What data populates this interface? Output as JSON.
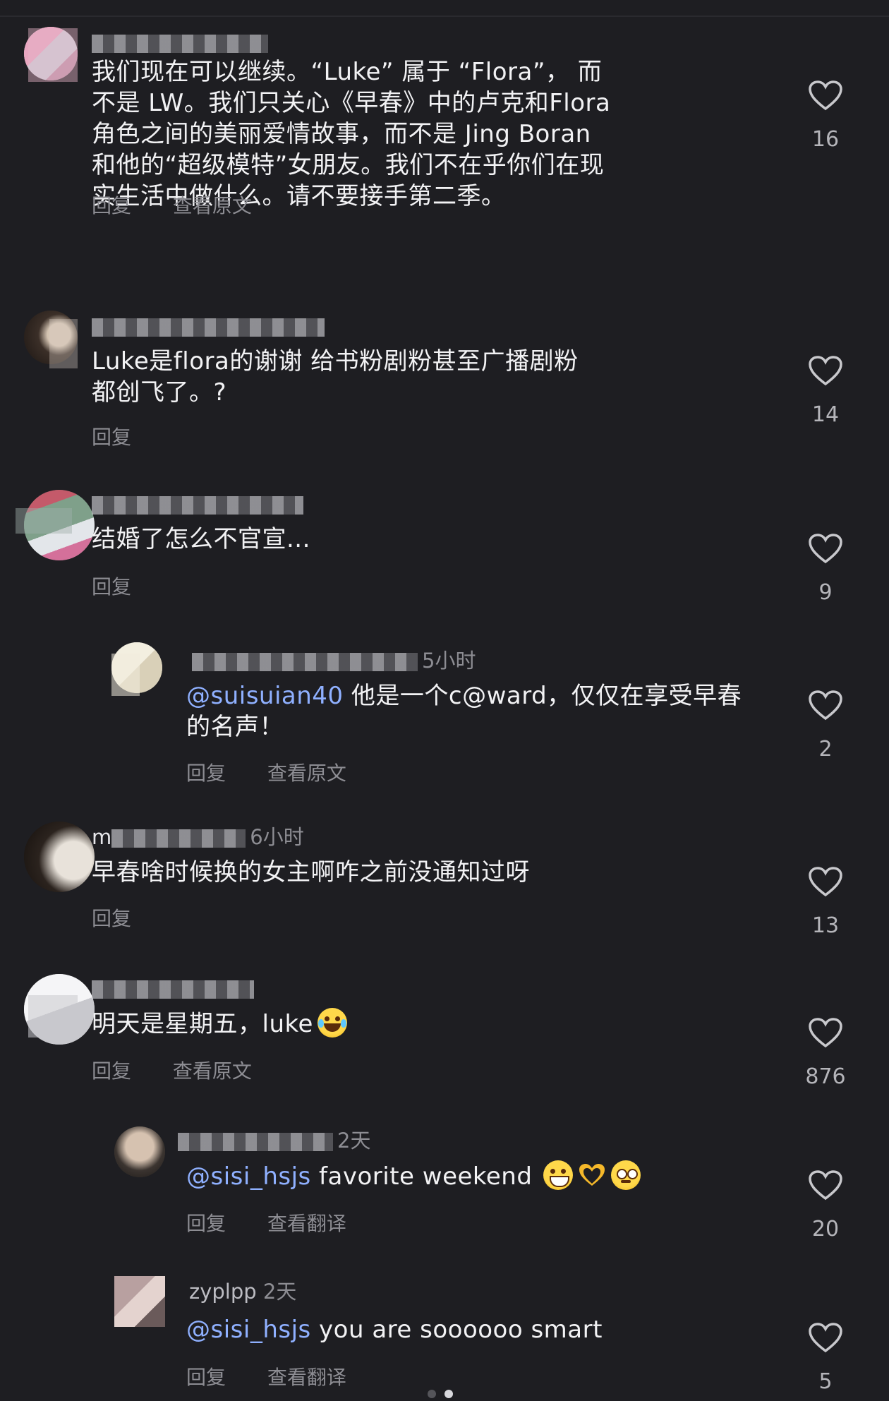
{
  "labels": {
    "reply": "回复",
    "view_original": "查看原文",
    "view_translation": "查看翻译"
  },
  "comments": [
    {
      "meta_suffix": "",
      "text": "我们现在可以继续。“Luke” 属于 “Flora”， 而不是 LW。我们只关心《早春》中的卢克和Flora角色之间的美丽爱情故事，而不是 Jing Boran和他的“超级模特”女朋友。我们不在乎你们在现实生活中做什么。请不要接手第二季。",
      "likes": "16",
      "has_view_original": true
    },
    {
      "meta_suffix": "",
      "text": "Luke是flora的谢谢 给书粉剧粉甚至广播剧粉都创飞了。?",
      "likes": "14"
    },
    {
      "meta_suffix": "",
      "text": "结婚了怎么不官宣...",
      "likes": "9"
    },
    {
      "meta_suffix": "5小时",
      "mention": "@suisuian40",
      "text": " 他是一个c@ward，仅仅在享受早春的名声！",
      "likes": "2",
      "has_view_original": true
    },
    {
      "meta_prefix": "m",
      "meta_suffix": "6小时",
      "text": "早春啥时候换的女主啊咋之前没通知过呀",
      "likes": "13"
    },
    {
      "meta_suffix": "",
      "text": "明天是星期五，luke",
      "emoji": "laughing-crying-emoji",
      "likes": "876",
      "has_view_original": true
    },
    {
      "meta_suffix": "2天",
      "mention": "@sisi_hsjs",
      "text": " favorite weekend",
      "emojis": [
        "grinning-emoji",
        "heart-hands-emoji",
        "pleading-emoji"
      ],
      "likes": "20",
      "has_view_translation": true
    },
    {
      "meta_prefix": "zyplpp",
      "meta_suffix": "2天",
      "mention": "@sisi_hsjs",
      "text": " you are soooooo smart",
      "likes": "5",
      "has_view_translation": true
    }
  ],
  "colors": {
    "background": "#1e1e22",
    "mention": "#8fb0ff",
    "secondary_text": "#8d8d93"
  }
}
